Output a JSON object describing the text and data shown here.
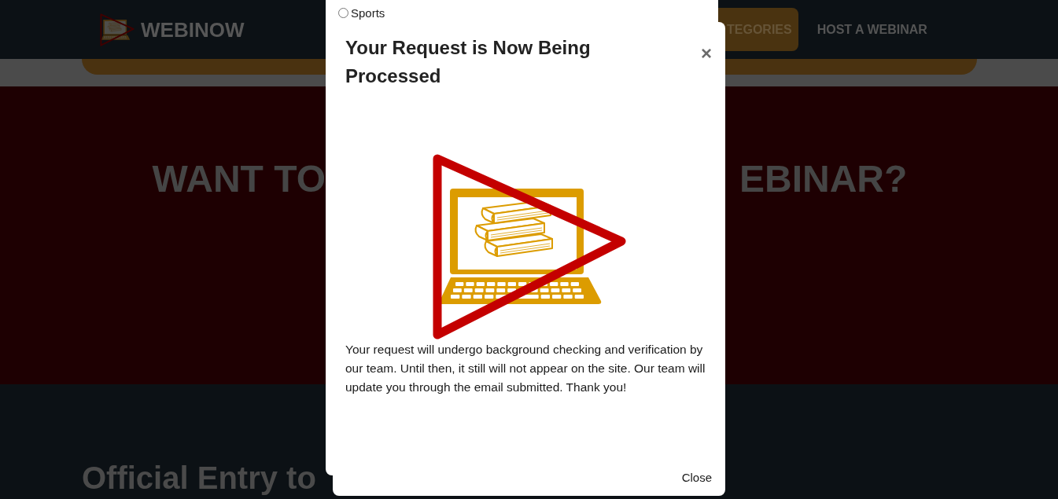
{
  "page": {
    "header": {
      "site_name": "WEBINOW",
      "nav": [
        {
          "label": "TEGORIES",
          "selected": true
        },
        {
          "label": "HOST A WEBINAR",
          "selected": false
        }
      ]
    },
    "hero": {
      "heading_left": "WANT TO",
      "heading_right": "EBINAR?"
    },
    "section": {
      "heading": "Official Entry to"
    }
  },
  "form_panel": {
    "options": [
      {
        "label": "Sports",
        "selected": false
      }
    ]
  },
  "dialog": {
    "title": "Your Request is Now Being Processed",
    "close_icon": "×",
    "message": "Your request will undergo background checking and verification by our team. Until then, it still will not appear on the site. Our team will update you through the email submitted. Thank you!",
    "buttons": [
      "Close"
    ]
  }
}
